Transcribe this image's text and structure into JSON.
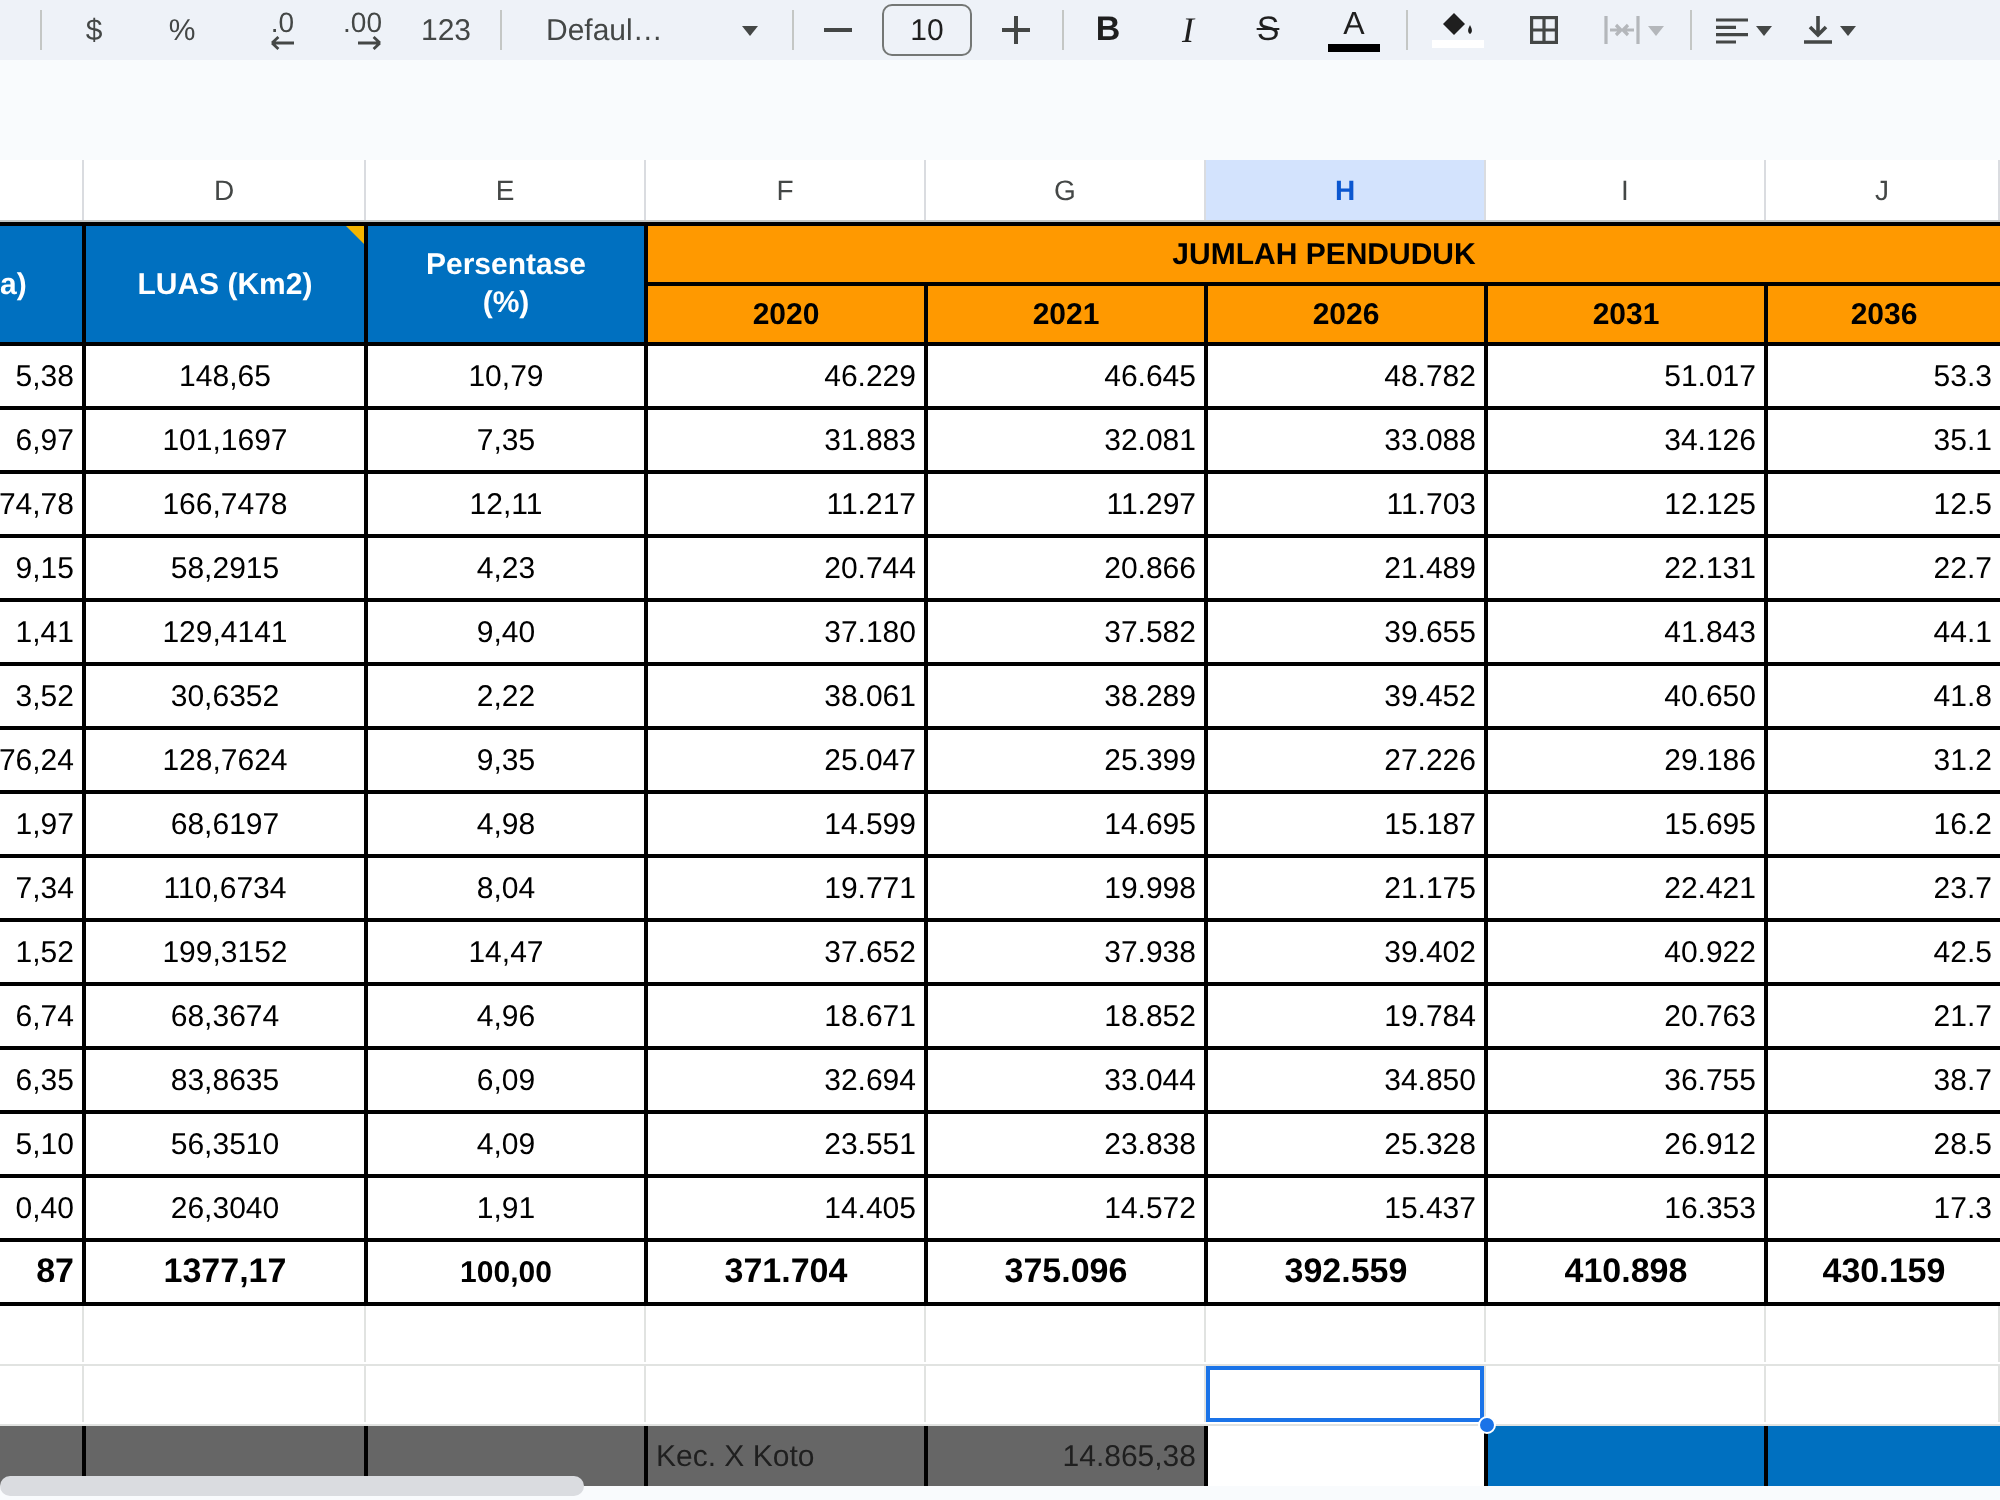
{
  "toolbar": {
    "groups": [
      {
        "items": [
          {
            "kind": "currency",
            "label": "$",
            "disabled": false
          },
          {
            "kind": "percent",
            "label": "%",
            "disabled": false
          },
          {
            "kind": "decimal-decrease",
            "label": ".0",
            "disabled": false
          },
          {
            "kind": "decimal-increase",
            "label": ".00",
            "disabled": false
          },
          {
            "kind": "number-format",
            "label": "123",
            "disabled": false
          }
        ]
      },
      {
        "items": [
          {
            "kind": "font",
            "value": "Defaul…",
            "disabled": false
          }
        ]
      },
      {
        "items": [
          {
            "kind": "size-decrease",
            "disabled": false
          },
          {
            "kind": "size",
            "value": "10",
            "disabled": false
          },
          {
            "kind": "size-increase",
            "disabled": false
          }
        ]
      },
      {
        "items": [
          {
            "kind": "bold",
            "label": "B",
            "disabled": false
          },
          {
            "kind": "italic",
            "label": "I",
            "disabled": false
          },
          {
            "kind": "strikethrough",
            "label": "S",
            "disabled": false
          },
          {
            "kind": "text-color",
            "label": "A",
            "color": "#000000",
            "disabled": false
          }
        ]
      },
      {
        "items": [
          {
            "kind": "fill-color",
            "color": "#ffffff",
            "disabled": false
          },
          {
            "kind": "borders",
            "disabled": false
          },
          {
            "kind": "merge",
            "disabled": true
          }
        ]
      },
      {
        "items": [
          {
            "kind": "align",
            "disabled": false
          },
          {
            "kind": "vertical-align",
            "disabled": false
          }
        ]
      }
    ]
  },
  "sheet": {
    "columns": [
      {
        "selected": false
      },
      {
        "letter": "D",
        "selected": false
      },
      {
        "letter": "E",
        "selected": false
      },
      {
        "letter": "F",
        "selected": false
      },
      {
        "letter": "G",
        "selected": false
      },
      {
        "letter": "H",
        "selected": true
      },
      {
        "letter": "I",
        "selected": false
      },
      {
        "letter": "J",
        "selected": false
      }
    ],
    "header": {
      "cells": [
        {
          "text": "a)",
          "has_note": false
        },
        {
          "text": "LUAS (Km2)",
          "has_note": true
        },
        {
          "text": "Persentase (%)",
          "has_note": false
        }
      ],
      "group": "JUMLAH PENDUDUK",
      "years": [
        "2020",
        "2021",
        "2026",
        "2031",
        "2036"
      ]
    },
    "rows": [
      {
        "cells": [
          "5,38",
          "148,65",
          "10,79",
          "46.229",
          "46.645",
          "48.782",
          "51.017",
          "53.3"
        ]
      },
      {
        "cells": [
          "6,97",
          "101,1697",
          "7,35",
          "31.883",
          "32.081",
          "33.088",
          "34.126",
          "35.1"
        ]
      },
      {
        "cells": [
          "74,78",
          "166,7478",
          "12,11",
          "11.217",
          "11.297",
          "11.703",
          "12.125",
          "12.5"
        ]
      },
      {
        "cells": [
          "9,15",
          "58,2915",
          "4,23",
          "20.744",
          "20.866",
          "21.489",
          "22.131",
          "22.7"
        ]
      },
      {
        "cells": [
          "1,41",
          "129,4141",
          "9,40",
          "37.180",
          "37.582",
          "39.655",
          "41.843",
          "44.1"
        ]
      },
      {
        "cells": [
          "3,52",
          "30,6352",
          "2,22",
          "38.061",
          "38.289",
          "39.452",
          "40.650",
          "41.8"
        ]
      },
      {
        "cells": [
          "76,24",
          "128,7624",
          "9,35",
          "25.047",
          "25.399",
          "27.226",
          "29.186",
          "31.2"
        ]
      },
      {
        "cells": [
          "1,97",
          "68,6197",
          "4,98",
          "14.599",
          "14.695",
          "15.187",
          "15.695",
          "16.2"
        ]
      },
      {
        "cells": [
          "7,34",
          "110,6734",
          "8,04",
          "19.771",
          "19.998",
          "21.175",
          "22.421",
          "23.7"
        ]
      },
      {
        "cells": [
          "1,52",
          "199,3152",
          "14,47",
          "37.652",
          "37.938",
          "39.402",
          "40.922",
          "42.5"
        ]
      },
      {
        "cells": [
          "6,74",
          "68,3674",
          "4,96",
          "18.671",
          "18.852",
          "19.784",
          "20.763",
          "21.7"
        ]
      },
      {
        "cells": [
          "6,35",
          "83,8635",
          "6,09",
          "32.694",
          "33.044",
          "34.850",
          "36.755",
          "38.7"
        ]
      },
      {
        "cells": [
          "5,10",
          "56,3510",
          "4,09",
          "23.551",
          "23.838",
          "25.328",
          "26.912",
          "28.5"
        ]
      },
      {
        "cells": [
          "0,40",
          "26,3040",
          "1,91",
          "14.405",
          "14.572",
          "15.437",
          "16.353",
          "17.3"
        ]
      }
    ],
    "total": {
      "cells": [
        "87",
        "1377,17",
        "100,00",
        "371.704",
        "375.096",
        "392.559",
        "410.898",
        "430.159"
      ]
    },
    "blank_rows": [
      {
        "cells": [
          {
            "selected": false
          },
          {
            "selected": false
          },
          {
            "selected": false
          },
          {
            "selected": false
          },
          {
            "selected": false
          },
          {
            "selected": false
          },
          {
            "selected": false
          },
          {
            "selected": false
          }
        ]
      },
      {
        "cells": [
          {
            "selected": false
          },
          {
            "selected": false
          },
          {
            "selected": false
          },
          {
            "selected": false
          },
          {
            "selected": false
          },
          {
            "selected": true
          },
          {
            "selected": false
          },
          {
            "selected": false
          }
        ]
      }
    ],
    "partial_row": {
      "cells": [
        {
          "color": "#666666"
        },
        {
          "color": "#666666"
        },
        {
          "color": "#666666"
        },
        {
          "text": "Kec. X Koto",
          "color": "#666666"
        },
        {
          "text": "14.865,38",
          "color": "#666666"
        },
        {
          "color": "#ffffff"
        },
        {
          "color": "#0070c0"
        },
        {
          "color": "#0070c0"
        }
      ]
    }
  }
}
